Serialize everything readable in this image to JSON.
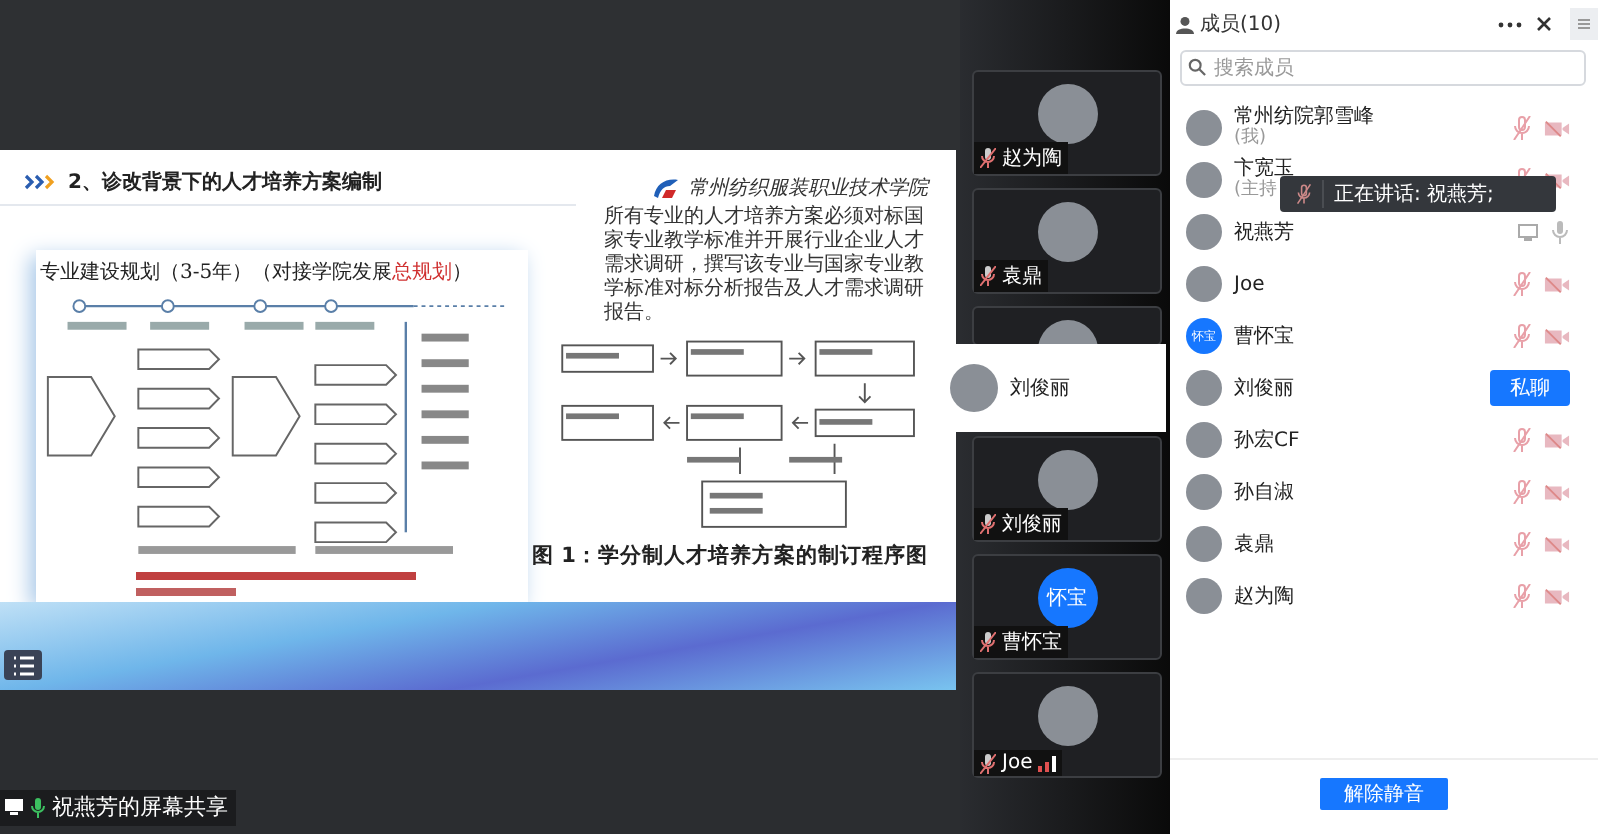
{
  "slide": {
    "section_title": "2、诊改背景下的人才培养方案编制",
    "plan_title": [
      {
        "text": "专业建设规划（3-5年）（对接学院发展",
        "highlight": false
      },
      {
        "text": "总规划",
        "highlight": true
      },
      {
        "text": "）",
        "highlight": false
      }
    ],
    "school_name": "常州纺织服装职业技术学院",
    "paragraph": "所有专业的人才培养方案必须对标国家专业教学标准并开展行业企业人才需求调研，撰写该专业与国家专业教学标准对标分析报告及人才需求调研报告。",
    "figure_caption": "图 1：学分制人才培养方案的制订程序图"
  },
  "share_label": "祝燕芳的屏幕共享",
  "video_tiles": [
    {
      "name": "赵为陶",
      "signal": false,
      "covered": false
    },
    {
      "name": "袁鼎",
      "signal": false,
      "covered": false
    },
    {
      "covered": true
    },
    {
      "name": "刘俊丽",
      "signal": false,
      "covered": false
    },
    {
      "name": "曹怀宝",
      "avatar_text": "怀宝",
      "signal": false,
      "covered": false
    },
    {
      "name": "Joe",
      "signal": true,
      "covered": false
    }
  ],
  "hover_card": {
    "name": "刘俊丽"
  },
  "members_panel": {
    "title": "成员(10)",
    "search": {
      "placeholder": "搜索成员"
    },
    "members": [
      {
        "name": "常州纺院郭雪峰",
        "note": "(我)",
        "mic_muted": true,
        "video_off": true
      },
      {
        "name": "卞宽玉",
        "note": "(主持",
        "mic_muted": true,
        "video_off": true
      },
      {
        "name": "祝燕芳",
        "mic_muted": false,
        "sharing": true
      },
      {
        "name": "Joe",
        "mic_muted": true,
        "video_off": true
      },
      {
        "name": "曹怀宝",
        "avatar_text": "怀宝",
        "mic_muted": true,
        "video_off": true
      },
      {
        "name": "刘俊丽",
        "chat_button": "私聊"
      },
      {
        "name": "孙宏CF",
        "mic_muted": true,
        "video_off": true
      },
      {
        "name": "孙自淑",
        "mic_muted": true,
        "video_off": true
      },
      {
        "name": "袁鼎",
        "mic_muted": true,
        "video_off": true
      },
      {
        "name": "赵为陶",
        "mic_muted": true,
        "video_off": true
      }
    ],
    "unmute_all_button": "解除静音"
  },
  "speaking_tooltip": {
    "text": "正在讲话: 祝燕芳;"
  }
}
